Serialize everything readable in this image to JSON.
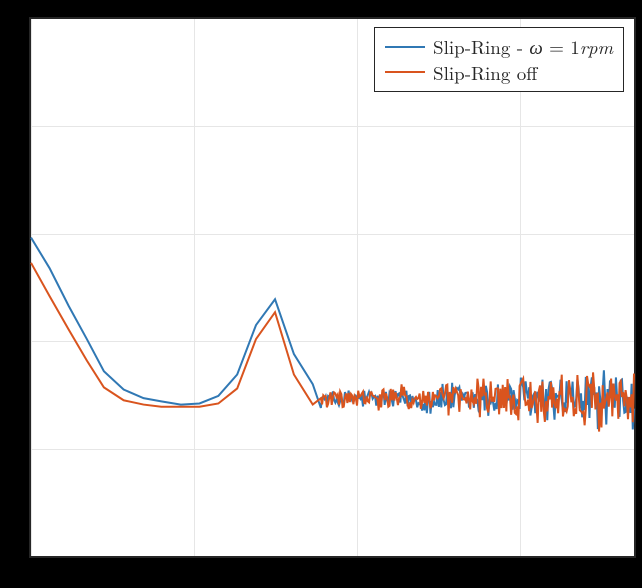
{
  "legend": {
    "entries": [
      {
        "label_pre": "Slip-Ring - ",
        "var": "ω",
        "eq": " = 1",
        "unit": "rpm"
      },
      {
        "label": "Slip-Ring off"
      }
    ]
  },
  "colors": {
    "series1": "#3078b4",
    "series2": "#d9541e",
    "grid": "#e6e6e6",
    "axis": "#262626"
  },
  "chart_data": {
    "type": "line",
    "x_scale": "log",
    "xlim": [
      0.1,
      500
    ],
    "ylim": [
      0,
      1
    ],
    "xlabel": "",
    "ylabel": "",
    "title": "",
    "series": [
      {
        "name": "Slip-Ring - ω = 1rpm",
        "x": [
          0.1,
          0.13,
          0.17,
          0.22,
          0.28,
          0.37,
          0.49,
          0.63,
          0.83,
          1.08,
          1.41,
          1.84,
          2.4,
          3.14,
          4.1,
          5.35,
          6.99,
          9.13,
          11.93,
          15.58,
          20.35,
          26.58,
          34.72,
          45.35,
          59.22,
          77.35,
          101.03,
          131.96,
          172.36,
          225.13,
          294.06,
          384.08,
          500.0
        ],
        "y": [
          0.593,
          0.536,
          0.466,
          0.404,
          0.344,
          0.31,
          0.294,
          0.288,
          0.282,
          0.284,
          0.298,
          0.338,
          0.43,
          0.478,
          0.376,
          0.32,
          0.308,
          0.296,
          0.302,
          0.294,
          0.288,
          0.299,
          0.294,
          0.293,
          0.29,
          0.292,
          0.294,
          0.296,
          0.293,
          0.292,
          0.291,
          0.291,
          0.291
        ]
      },
      {
        "name": "Slip-Ring off",
        "x": [
          0.1,
          0.13,
          0.17,
          0.22,
          0.28,
          0.37,
          0.49,
          0.63,
          0.83,
          1.08,
          1.41,
          1.84,
          2.4,
          3.14,
          4.1,
          5.35,
          6.99,
          9.13,
          11.93,
          15.58,
          20.35,
          26.58,
          34.72,
          45.35,
          59.22,
          77.35,
          101.03,
          131.96,
          172.36,
          225.13,
          294.06,
          384.08,
          500.0
        ],
        "y": [
          0.546,
          0.484,
          0.422,
          0.364,
          0.314,
          0.29,
          0.282,
          0.278,
          0.278,
          0.278,
          0.284,
          0.312,
          0.404,
          0.454,
          0.338,
          0.282,
          0.269,
          0.273,
          0.28,
          0.289,
          0.29,
          0.291,
          0.292,
          0.292,
          0.292,
          0.291,
          0.291,
          0.291,
          0.292,
          0.291,
          0.291,
          0.292,
          0.292
        ]
      }
    ],
    "x_gridlines": [
      0.1,
      1,
      10,
      100
    ],
    "y_gridlines": [
      0.2,
      0.4,
      0.6,
      0.8
    ]
  }
}
